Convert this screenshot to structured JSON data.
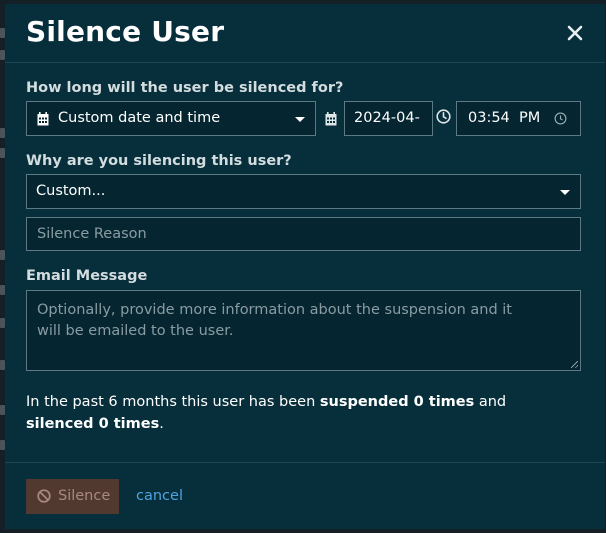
{
  "modal": {
    "title": "Silence User",
    "close_icon": "close-icon"
  },
  "duration": {
    "label": "How long will the user be silenced for?",
    "select_value": "Custom date and time",
    "date_value": "2024-04-",
    "time_value": "03:54  PM"
  },
  "reason": {
    "label": "Why are you silencing this user?",
    "select_value": "Custom...",
    "input_placeholder": "Silence Reason"
  },
  "email": {
    "label": "Email Message",
    "placeholder": "Optionally, provide more information about the suspension and it will be emailed to the user."
  },
  "summary": {
    "prefix": "In the past 6 months this user has been ",
    "suspended": "suspended 0 times",
    "middle": " and ",
    "silenced": "silenced 0 times",
    "suffix": "."
  },
  "footer": {
    "silence_label": "Silence",
    "cancel_label": "cancel"
  },
  "colors": {
    "modal_bg": "#072f3b",
    "link": "#4fa3e0",
    "danger_disabled": "#52392f"
  }
}
